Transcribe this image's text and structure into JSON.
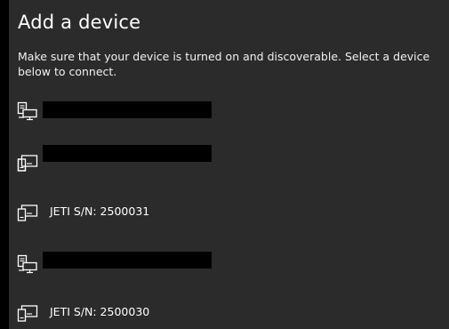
{
  "dialog": {
    "title": "Add a device",
    "description": "Make sure that your device is turned on and discoverable. Select a device below to connect."
  },
  "devices": [
    {
      "icon": "computer-icon",
      "label": "",
      "redacted": true
    },
    {
      "icon": "display-device-icon",
      "label": "",
      "redacted": true
    },
    {
      "icon": "display-device-icon",
      "label": "JETI S/N: 2500031",
      "redacted": false
    },
    {
      "icon": "computer-icon",
      "label": "",
      "redacted": true
    },
    {
      "icon": "display-device-icon",
      "label": "JETI S/N: 2500030",
      "redacted": false
    }
  ],
  "colors": {
    "background": "#2b2b2b",
    "text": "#ffffff",
    "redaction": "#000000"
  }
}
